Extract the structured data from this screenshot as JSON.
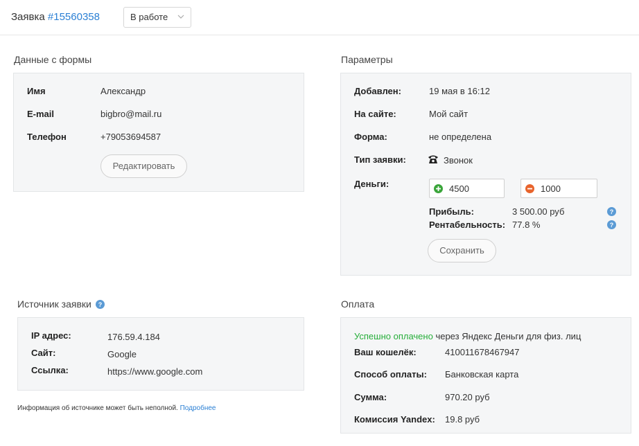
{
  "header": {
    "title_prefix": "Заявка",
    "request_number": "#15560358",
    "status_value": "В работе"
  },
  "form_data": {
    "title": "Данные с формы",
    "fields": [
      {
        "label": "Имя",
        "value": "Александр"
      },
      {
        "label": "E-mail",
        "value": "bigbro@mail.ru"
      },
      {
        "label": "Телефон",
        "value": "+79053694587"
      }
    ],
    "edit_button": "Редактировать"
  },
  "params": {
    "title": "Параметры",
    "added_label": "Добавлен:",
    "added_value": "19 мая в 16:12",
    "site_label": "На сайте:",
    "site_value": "Мой сайт",
    "form_label": "Форма:",
    "form_value": "не определена",
    "type_label": "Тип заявки:",
    "type_value": "Звонок",
    "money_label": "Деньги:",
    "income_value": "4500",
    "expense_value": "1000",
    "profit_label": "Прибыль:",
    "profit_value": "3 500.00 руб",
    "profitability_label": "Рентабельность:",
    "profitability_value": "77.8 %",
    "save_button": "Сохранить"
  },
  "source": {
    "title": "Источник заявки",
    "ip_label": "IP адрес:",
    "ip_value": "176.59.4.184",
    "site_label": "Сайт:",
    "site_value": "Google",
    "link_label": "Ссылка:",
    "link_value": "https://www.google.com",
    "note_text": "Информация об источнике может быть неполной.",
    "note_link": "Подробнее"
  },
  "payment": {
    "title": "Оплата",
    "status_text": "Успешно оплачено",
    "status_suffix": "через Яндекс Деньги для физ. лиц",
    "wallet_label": "Ваш кошелёк:",
    "wallet_value": "410011678467947",
    "method_label": "Способ оплаты:",
    "method_value": "Банковская карта",
    "sum_label": "Сумма:",
    "sum_value": "970.20 руб",
    "fee_label": "Комиссия Yandex:",
    "fee_value": "19.8 руб"
  },
  "colors": {
    "link": "#2a7fd4",
    "success": "#27ae3a",
    "income_icon": "#3aa53a",
    "expense_icon": "#e8642c",
    "help_icon": "#5b9bd5",
    "panel_bg": "#f5f6f7"
  },
  "icons": {
    "status_dropdown": "chevron-down-icon",
    "call_type": "phone-icon",
    "income": "plus-circle-icon",
    "expense": "minus-circle-icon",
    "help": "question-circle-icon"
  }
}
